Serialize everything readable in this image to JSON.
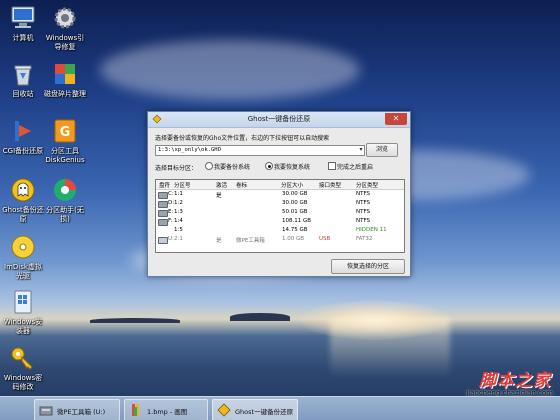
{
  "desktop": {
    "icons": [
      {
        "label": "计算机",
        "icon": "computer-icon"
      },
      {
        "label": "Windows引\n导修复",
        "icon": "gear-icon"
      },
      {
        "label": "回收站",
        "icon": "recycle-bin-icon"
      },
      {
        "label": "磁盘碎片整理",
        "icon": "defrag-icon"
      },
      {
        "label": "CGI备份还原",
        "icon": "cgi-backup-icon"
      },
      {
        "label": "分区工具\nDiskGenius",
        "icon": "diskgenius-icon"
      },
      {
        "label": "Ghost备份还\n原",
        "icon": "ghost-icon"
      },
      {
        "label": "分区助手(无\n损)",
        "icon": "partition-assistant-icon"
      },
      {
        "label": "ImDisk虚拟\n光驱",
        "icon": "imdisk-icon"
      },
      {
        "label": "Windows安\n装器",
        "icon": "windows-installer-icon"
      },
      {
        "label": "Windows密\n码修改",
        "icon": "password-key-icon"
      }
    ]
  },
  "dialog": {
    "title": "Ghost一键备份还原",
    "instruction": "选择要备份或恢复的Gho文件位置，右边的下拉按钮可以自动搜索",
    "path_value": "1:3:\\xp_only\\ok.GHO",
    "browse_label": "浏览",
    "target_label": "选择目标分区：",
    "radio_backup": "我要备份系统",
    "radio_restore": "我要恢复系统",
    "checkbox_reboot": "完成之后重启",
    "restore_button": "恢复选择的分区",
    "columns": [
      "盘符",
      "分区号",
      "激活",
      "卷标",
      "分区大小",
      "接口类型",
      "分区类型"
    ],
    "rows": [
      {
        "drive": "C:",
        "part": "1:1",
        "active": "是",
        "label": "",
        "size": "30.00 GB",
        "iface": "",
        "type": "NTFS"
      },
      {
        "drive": "D:",
        "part": "1:2",
        "active": "",
        "label": "",
        "size": "30.00 GB",
        "iface": "",
        "type": "NTFS"
      },
      {
        "drive": "E:",
        "part": "1:3",
        "active": "",
        "label": "",
        "size": "50.01 GB",
        "iface": "",
        "type": "NTFS"
      },
      {
        "drive": "F:",
        "part": "1:4",
        "active": "",
        "label": "",
        "size": "108.11 GB",
        "iface": "",
        "type": "NTFS"
      },
      {
        "drive": "",
        "part": "1:5",
        "active": "",
        "label": "",
        "size": "14.75 GB",
        "iface": "",
        "type": "HIDDEN 11"
      },
      {
        "drive": "U:",
        "part": "2:1",
        "active": "是",
        "label": "微PE工具箱",
        "size": "1.00 GB",
        "iface": "USB",
        "type": "FAT32"
      }
    ]
  },
  "taskbar": {
    "items": [
      {
        "label": "微PE工具箱 (U:)",
        "icon": "folder-drive-icon"
      },
      {
        "label": "1.bmp - 画图",
        "icon": "paint-icon"
      },
      {
        "label": "Ghost一键备份还原",
        "icon": "ghost-icon"
      }
    ]
  },
  "watermark": {
    "title": "脚本之家",
    "url": "jiaocheng.chazidian.com"
  },
  "colors": {
    "accent": "#c9443b",
    "usb": "#d04040",
    "hidden": "#2e8b2e"
  }
}
